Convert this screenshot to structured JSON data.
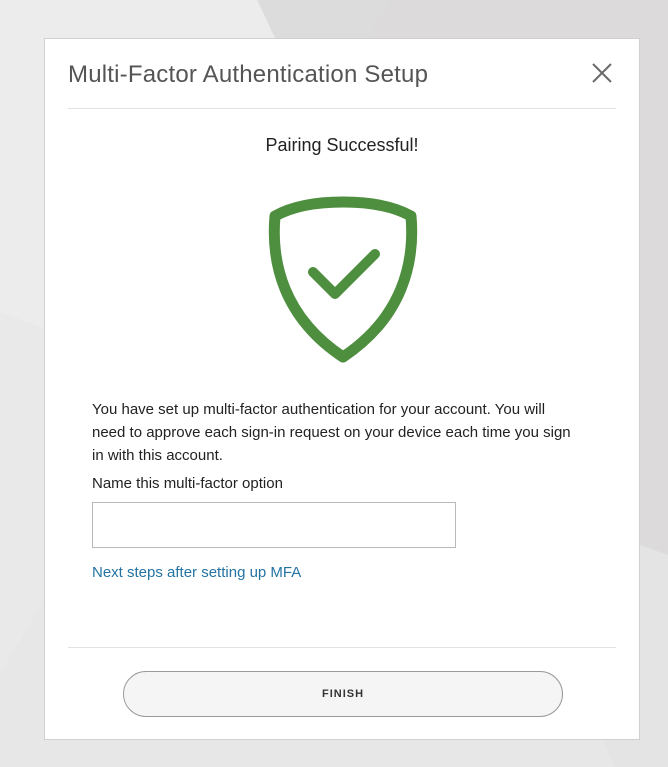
{
  "dialog": {
    "title": "Multi-Factor Authentication Setup",
    "close_icon": "close-icon",
    "subtitle": "Pairing Successful!",
    "status_icon": "shield-check-icon",
    "status_color": "#4e8e3f",
    "message": "You have set up multi-factor authentication for your account. You will need to approve each sign-in request on your device each time you sign in with this account.",
    "field_label": "Name this multi-factor option",
    "field_value": "",
    "field_placeholder": "",
    "next_steps_link": "Next steps after setting up MFA",
    "link_color": "#2473a3",
    "finish_label": "FINISH"
  }
}
